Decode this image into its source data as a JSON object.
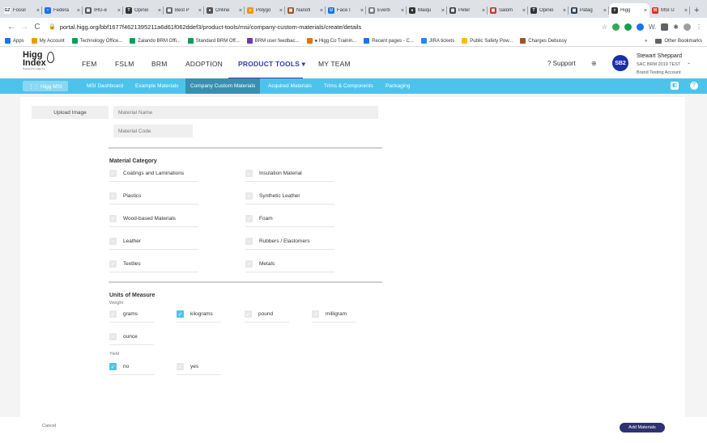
{
  "browser": {
    "tabs": [
      {
        "label": "Fossil",
        "fav": "GZ",
        "color": "#ffffff",
        "textColor": "#333333"
      },
      {
        "label": "Federa",
        "fav": "•",
        "color": "#1a73e8"
      },
      {
        "label": "IHG-e",
        "fav": "▣",
        "color": "#555555"
      },
      {
        "label": "Opinio",
        "fav": "T",
        "color": "#333333"
      },
      {
        "label": "Best P",
        "fav": "▣",
        "color": "#666666"
      },
      {
        "label": "Online",
        "fav": "●",
        "color": "#555555"
      },
      {
        "label": "Polygo",
        "fav": "●",
        "color": "#f29900"
      },
      {
        "label": "Nanofi",
        "fav": "▣",
        "color": "#a0522d"
      },
      {
        "label": "Face I",
        "fav": "U",
        "color": "#1a73e8"
      },
      {
        "label": "Everb",
        "fav": "▣",
        "color": "#7a7a7a"
      },
      {
        "label": "Maiqu",
        "fav": "●",
        "color": "#333333"
      },
      {
        "label": "Peter",
        "fav": "▣",
        "color": "#444444"
      },
      {
        "label": "Salom",
        "fav": "▣",
        "color": "#c0392b"
      },
      {
        "label": "Opinio",
        "fav": "T",
        "color": "#333333"
      },
      {
        "label": "Patag",
        "fav": "▣",
        "color": "#2c3e50"
      },
      {
        "label": "Higg",
        "fav": "◊",
        "color": "#333333",
        "active": true
      },
      {
        "label": "MSI U",
        "fav": "M",
        "color": "#d93025"
      }
    ],
    "url": "portal.higg.org/bbf1677f4621395211a6d61f062ddef3/product-tools/msi/company-custom-materials/create/details",
    "bookmarks": [
      {
        "label": "Apps",
        "color": "#1a73e8"
      },
      {
        "label": "My Account",
        "color": "#f29900"
      },
      {
        "label": "Technology Office...",
        "color": "#0f9d58"
      },
      {
        "label": "Zalando BRM Offi...",
        "color": "#0f9d58"
      },
      {
        "label": "Standard BRM Off...",
        "color": "#0f9d58"
      },
      {
        "label": "BRM user feedbac...",
        "color": "#673ab7"
      },
      {
        "label": "● Higg Co Trainin...",
        "color": "#e8710a"
      },
      {
        "label": "Recent pages - C...",
        "color": "#1a73e8"
      },
      {
        "label": "JIRA tickets",
        "color": "#2684ff"
      },
      {
        "label": "Public Safety Pow...",
        "color": "#fbbc04"
      },
      {
        "label": "Charges Debussy",
        "color": "#a0522d"
      }
    ],
    "bookmarks_more": "»",
    "other_bookmarks": "Other Bookmarks"
  },
  "header": {
    "logo": {
      "line1": "Higg",
      "line2": "Index",
      "line3": "Powered by Higg Co"
    },
    "nav": [
      {
        "label": "FEM"
      },
      {
        "label": "FSLM"
      },
      {
        "label": "BRM"
      },
      {
        "label": "ADOPTION"
      },
      {
        "label": "PRODUCT TOOLS ▾",
        "active": true
      },
      {
        "label": "MY TEAM"
      }
    ],
    "support": "? Support",
    "avatar": "SB2",
    "user_name": "Stewart Sheppard",
    "user_org": "SAC BRM 2019 TEST",
    "user_account": "Brand Testing Account"
  },
  "subnav": {
    "pill": "⋮⋮ Higg MSI",
    "items": [
      {
        "label": "MSI Dashboard"
      },
      {
        "label": "Example Materials"
      },
      {
        "label": "Company Custom Materials",
        "active": true
      },
      {
        "label": "Acquired Materials"
      },
      {
        "label": "Trims & Components"
      },
      {
        "label": "Packaging"
      }
    ]
  },
  "form": {
    "upload_image": "Upload Image",
    "material_name_placeholder": "Material Name",
    "material_code_placeholder": "Material Code",
    "category_title": "Material Category",
    "categories": [
      {
        "label": "Coatings and Laminations",
        "checked": false
      },
      {
        "label": "Insulation Material",
        "checked": false
      },
      {
        "label": "Plastics",
        "checked": false
      },
      {
        "label": "Synthetic Leather",
        "checked": false
      },
      {
        "label": "Wood-based Materials",
        "checked": false
      },
      {
        "label": "Foam",
        "checked": false
      },
      {
        "label": "Leather",
        "checked": false
      },
      {
        "label": "Rubbers / Elastomers",
        "checked": false
      },
      {
        "label": "Textiles",
        "checked": false
      },
      {
        "label": "Metals",
        "checked": false
      }
    ],
    "units_title": "Units of Measure",
    "weight_label": "Weight",
    "weight_units": [
      {
        "label": "grams",
        "checked": false
      },
      {
        "label": "kilograms",
        "checked": true
      },
      {
        "label": "pound",
        "checked": false
      },
      {
        "label": "milligram",
        "checked": false
      },
      {
        "label": "ounce",
        "checked": false
      }
    ],
    "yield_label": "Yield",
    "yield_options": [
      {
        "label": "no",
        "checked": true
      },
      {
        "label": "yes",
        "checked": false
      }
    ]
  },
  "footer": {
    "cancel": "Cancel",
    "add_materials": "Add Materials"
  },
  "colors": {
    "accent": "#4dc3ec",
    "nav_active": "#2d3fa8",
    "primary_button": "#2e3270",
    "avatar": "#1a2fa8"
  }
}
